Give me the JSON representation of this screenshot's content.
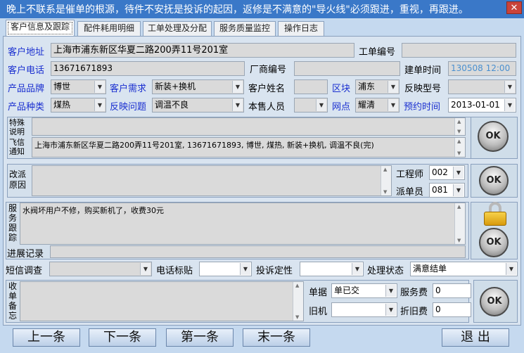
{
  "window": {
    "title": "晚上不联系是催单的根源，待件不安抚是投诉的起因，返修是不满意的\"导火线\"必须跟进，重视，再跟进。",
    "close_label": "✕"
  },
  "tabs": [
    {
      "label": "客户信息及跟踪"
    },
    {
      "label": "配件耗用明细"
    },
    {
      "label": "工单处理及分配"
    },
    {
      "label": "服务质量监控"
    },
    {
      "label": "操作日志"
    }
  ],
  "customer": {
    "address_label": "客户地址",
    "address": "上海市浦东新区华夏二路200弄11号201室",
    "order_no_label": "工单编号",
    "order_no": "",
    "phone_label": "客户电话",
    "phone": "13671671893",
    "factory_no_label": "厂商编号",
    "factory_no": "",
    "created_label": "建单时间",
    "created": "130508 12:00",
    "brand_label": "产品品牌",
    "brand": "博世",
    "demand_label": "客户需求",
    "demand": "新装+换机",
    "name_label": "客户姓名",
    "name": "",
    "district_label": "区块",
    "district": "浦东",
    "model_label": "反映型号",
    "model": "",
    "category_label": "产品种类",
    "category": "煤热",
    "issue_label": "反映问题",
    "issue": "调温不良",
    "seller_label": "本售人员",
    "seller": "",
    "site_label": "网点",
    "site": "耀清",
    "appt_label": "预约时间",
    "appt": "2013-01-01"
  },
  "special": {
    "label": "特殊说明",
    "value": ""
  },
  "notify": {
    "label": "飞信通知",
    "value": "上海市浦东新区华夏二路200弄11号201室, 13671671893, 博世, 煤热, 新装+换机, 调温不良(完)"
  },
  "reassign": {
    "label": "改派原因",
    "value": "",
    "engineer_label": "工程师",
    "engineer": "002",
    "dispatcher_label": "派单员",
    "dispatcher": "081"
  },
  "follow": {
    "label": "服务跟踪",
    "value": "水阀坏用户不修，购买新机了，收费30元",
    "progress_label": "进展记录",
    "progress": ""
  },
  "survey": {
    "sms_label": "短信调查",
    "sms": "",
    "phone_tag_label": "电话标贴",
    "phone_tag": "",
    "complaint_label": "投诉定性",
    "complaint": "",
    "status_label": "处理状态",
    "status": "满意结单"
  },
  "closing": {
    "label": "收单备忘",
    "value": "",
    "doc_label": "单据",
    "doc": "单已交",
    "service_fee_label": "服务费",
    "service_fee": "0",
    "old_label": "旧机",
    "old": "",
    "depreciation_label": "折旧费",
    "depreciation": "0"
  },
  "ok_label": "OK",
  "nav": {
    "prev": "上一条",
    "next": "下一条",
    "first": "第一条",
    "last": "末一条",
    "exit": "退 出"
  },
  "colors": {
    "title_bar": "#3a78c8",
    "label_blue": "#1a2fd0",
    "panel": "#d9e4f0"
  }
}
